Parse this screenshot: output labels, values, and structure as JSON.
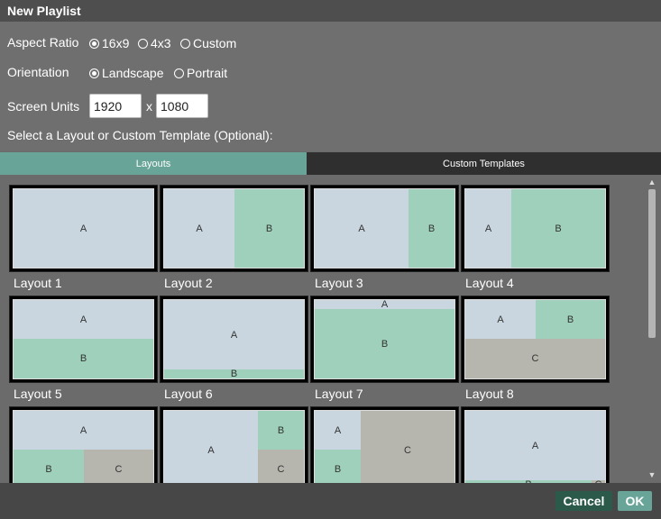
{
  "dialog": {
    "title": "New Playlist"
  },
  "form": {
    "aspect_ratio": {
      "label": "Aspect Ratio",
      "options": [
        {
          "label": "16x9",
          "selected": true
        },
        {
          "label": "4x3",
          "selected": false
        },
        {
          "label": "Custom",
          "selected": false
        }
      ]
    },
    "orientation": {
      "label": "Orientation",
      "options": [
        {
          "label": "Landscape",
          "selected": true
        },
        {
          "label": "Portrait",
          "selected": false
        }
      ]
    },
    "screen_units": {
      "label": "Screen Units",
      "width": "1920",
      "separator": "x",
      "height": "1080"
    },
    "layout_prompt": "Select a Layout or Custom Template (Optional):"
  },
  "tabs": [
    {
      "label": "Layouts",
      "active": true
    },
    {
      "label": "Custom Templates",
      "active": false
    }
  ],
  "layouts": [
    {
      "name": "Layout 1"
    },
    {
      "name": "Layout 2"
    },
    {
      "name": "Layout 3"
    },
    {
      "name": "Layout 4"
    },
    {
      "name": "Layout 5"
    },
    {
      "name": "Layout 6"
    },
    {
      "name": "Layout 7"
    },
    {
      "name": "Layout 8"
    },
    {
      "name": ""
    },
    {
      "name": ""
    },
    {
      "name": ""
    },
    {
      "name": ""
    }
  ],
  "region_labels": {
    "a": "A",
    "b": "B",
    "c": "C"
  },
  "scrollbar": {
    "up_icon": "triangle-up",
    "down_icon": "triangle-down"
  },
  "footer": {
    "cancel_label": "Cancel",
    "ok_label": "OK"
  },
  "colors": {
    "accent": "#68a598",
    "region_a": "#c9d6df",
    "region_b": "#9ed0bb",
    "region_c": "#b7b6ae"
  }
}
